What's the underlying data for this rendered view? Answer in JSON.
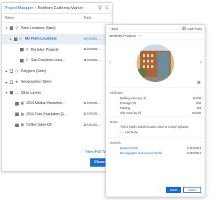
{
  "left": {
    "breadcrumb": {
      "link": "Project Manager",
      "separator": ">",
      "current": "Northern California Market"
    },
    "columns": {
      "name": "Name",
      "date": "Date"
    },
    "rows": [
      {
        "label": "Point Locations (Sites)",
        "date": ""
      },
      {
        "label": "My Point Locations",
        "date": "11/03/201…"
      },
      {
        "label": "Berkeley Property",
        "date": "11/03/201…"
      },
      {
        "label": "San Francisco Loca…",
        "date": "11/03/201…"
      },
      {
        "label": "Polygons (Sites)",
        "date": ""
      },
      {
        "label": "Geographies (Sites)",
        "date": ""
      },
      {
        "label": "Other Layers",
        "date": ""
      },
      {
        "label": "2016 Median Househol…",
        "date": "11/03/201…"
      },
      {
        "label": "2016 Total Population (E…",
        "date": "11/03/201…"
      },
      {
        "label": "Coffee Sales Q2",
        "date": "11/03/201…"
      }
    ],
    "more": "•••",
    "view_full_table": "View Full Tabl",
    "close": "Close"
  },
  "right": {
    "back": "Back",
    "add_photo": "Add Photo",
    "title": "Berkeley Property",
    "attributes_label": "Attributes",
    "attributes": [
      {
        "name": "Building Area (sq. ft)",
        "value": "15,000"
      },
      {
        "name": "Frontage (ft)",
        "value": "600"
      },
      {
        "name": "Parking",
        "value": "125"
      },
      {
        "name": "Site Area (sq. ft)",
        "value": "60,000"
      }
    ],
    "notes_label": "Notes",
    "note_text": "This is highly visible location close to a busy highway.",
    "add_note": "Add Note",
    "reports_label": "Reports",
    "reports": [
      {
        "name": "Market Profile",
        "date": "11/03/2016"
      },
      {
        "name": "Demographic and Income Profile",
        "date": "11/03/2016"
      }
    ],
    "back_button": "Back",
    "close_button": "Close"
  }
}
